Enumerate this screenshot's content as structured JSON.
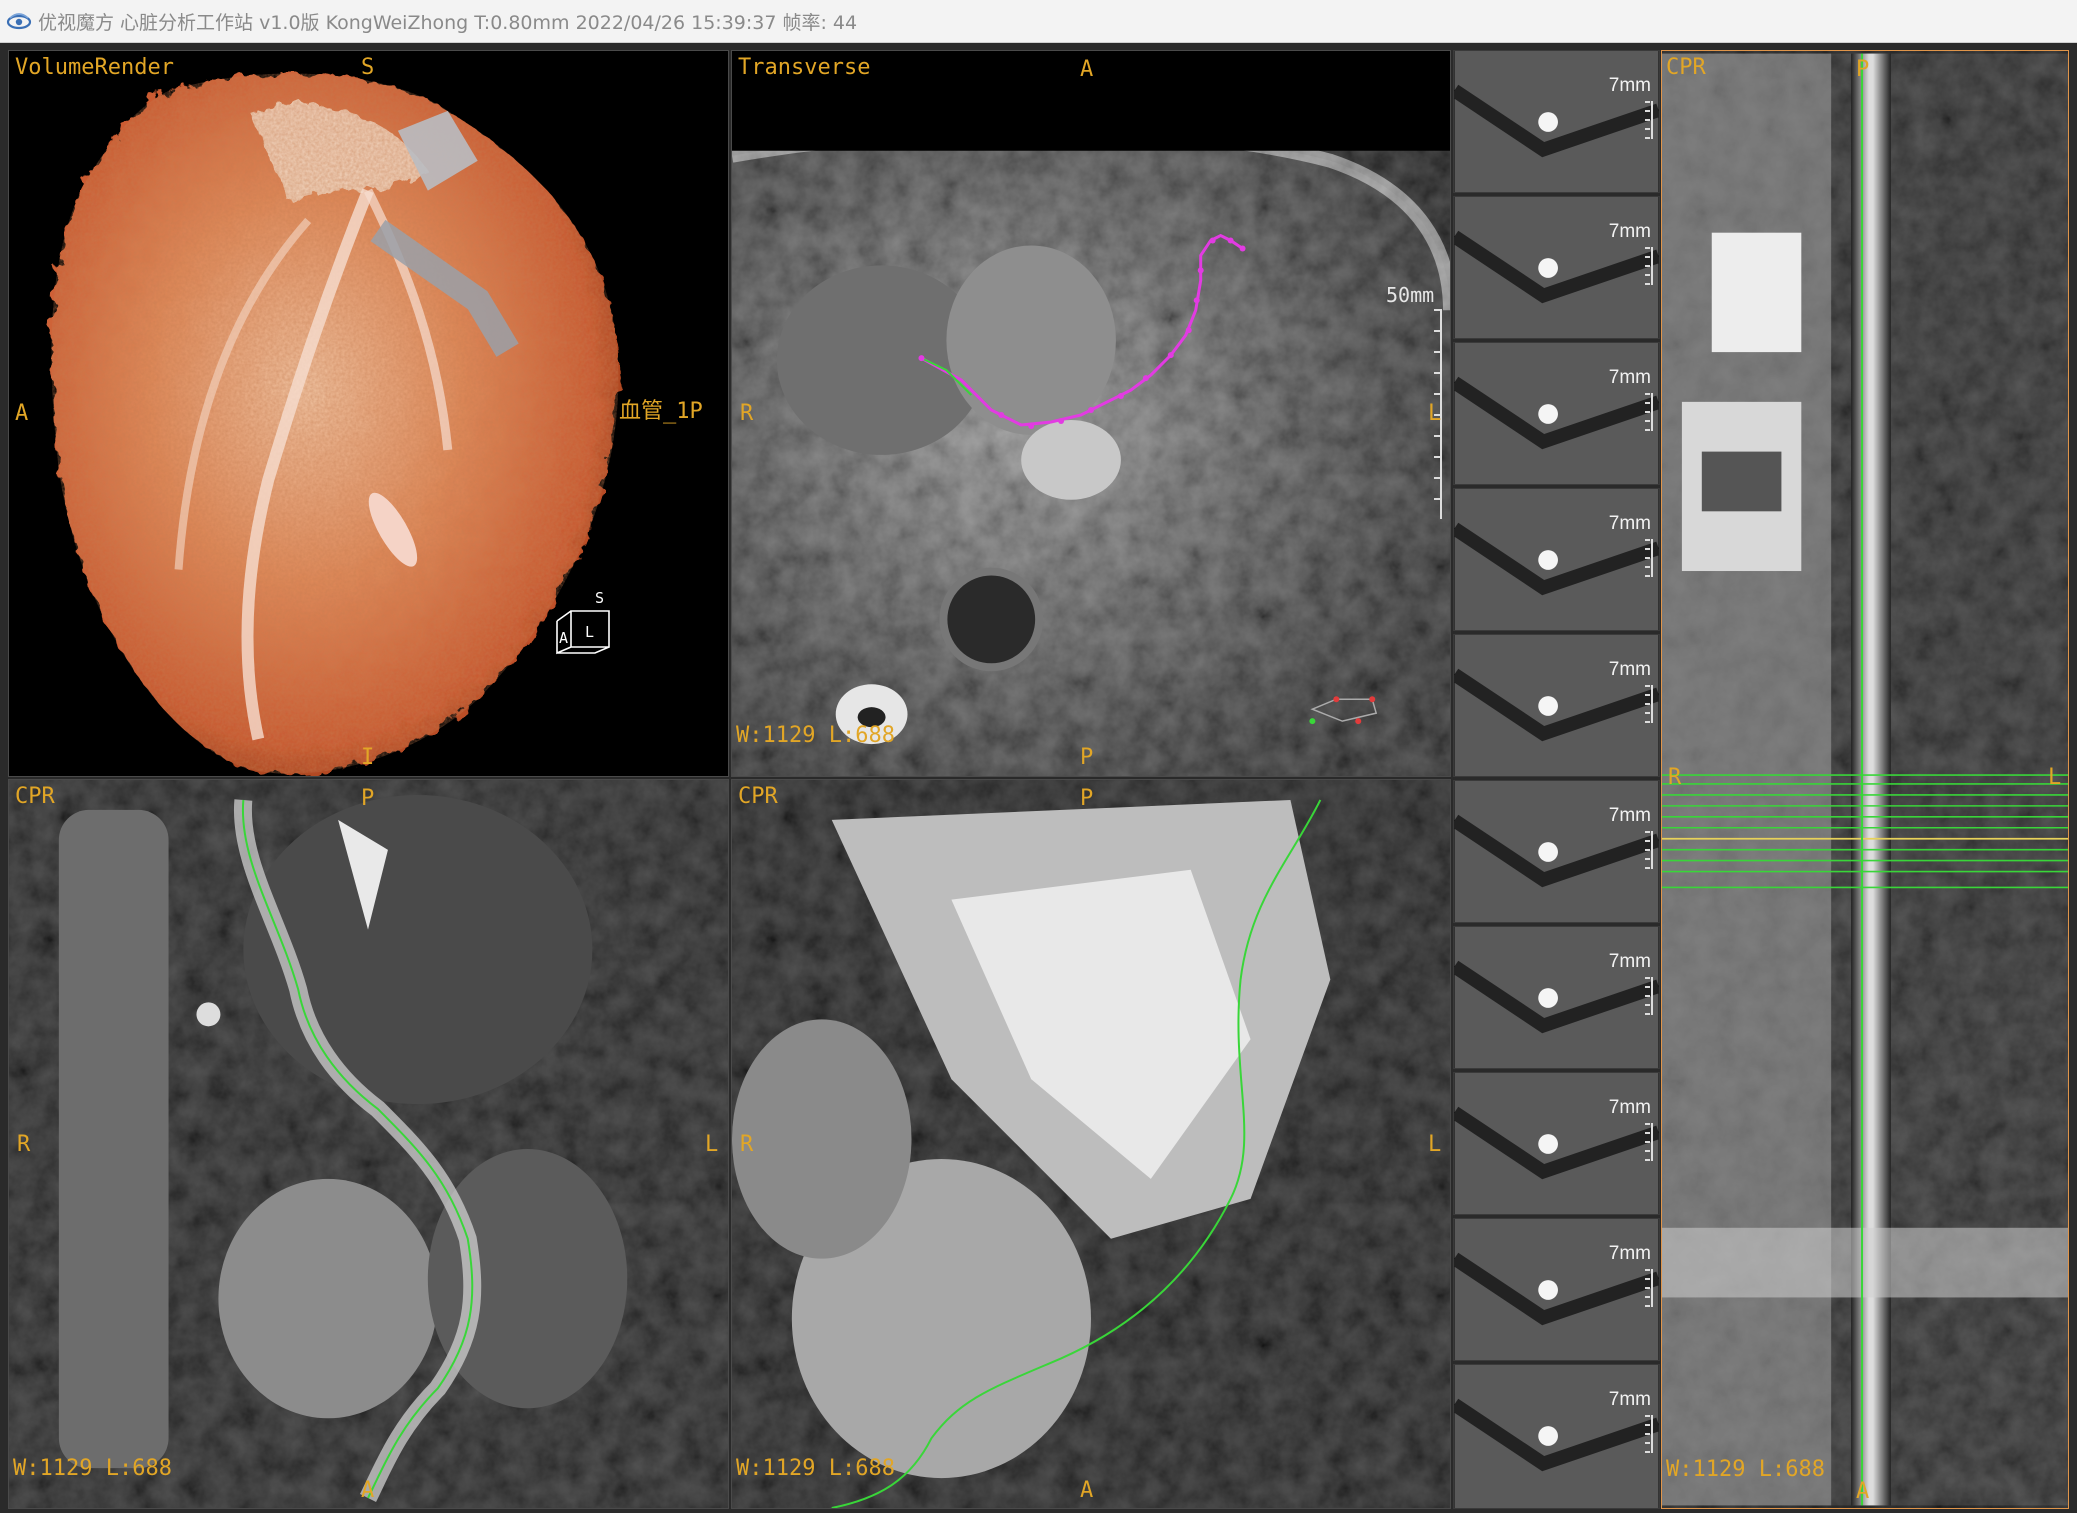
{
  "window": {
    "title": "优视魔方 心脏分析工作站 v1.0版 KongWeiZhong T:0.80mm 2022/04/26 15:39:37  帧率: 44"
  },
  "volume_render": {
    "label": "VolumeRender",
    "top": "S",
    "bottom": "I",
    "left": "A",
    "right": "血管_1P",
    "cube": {
      "top": "S",
      "left": "A",
      "front": "L"
    }
  },
  "transverse": {
    "label": "Transverse",
    "top": "A",
    "bottom": "P",
    "left": "R",
    "right": "L",
    "scale": "50mm",
    "wl": "W:1129 L:688"
  },
  "cpr_left": {
    "label": "CPR",
    "top": "P",
    "bottom": "A",
    "left": "R",
    "right": "L",
    "wl": "W:1129 L:688"
  },
  "cpr_middle": {
    "label": "CPR",
    "top": "P",
    "bottom": "A",
    "left": "R",
    "right": "L",
    "wl": "W:1129 L:688"
  },
  "cross_sections": [
    {
      "thickness": "7mm"
    },
    {
      "thickness": "7mm"
    },
    {
      "thickness": "7mm"
    },
    {
      "thickness": "7mm"
    },
    {
      "thickness": "7mm"
    },
    {
      "thickness": "7mm"
    },
    {
      "thickness": "7mm"
    },
    {
      "thickness": "7mm"
    },
    {
      "thickness": "7mm"
    },
    {
      "thickness": "7mm"
    }
  ],
  "straight_cpr": {
    "label": "CPR",
    "top": "P",
    "bottom": "A",
    "left": "R",
    "right": "L",
    "wl": "W:1129 L:688"
  },
  "colors": {
    "overlay_text": "#e2a626",
    "centerline": "#39d639",
    "curve_points": "#e23be2",
    "active_border": "#e0954a"
  }
}
